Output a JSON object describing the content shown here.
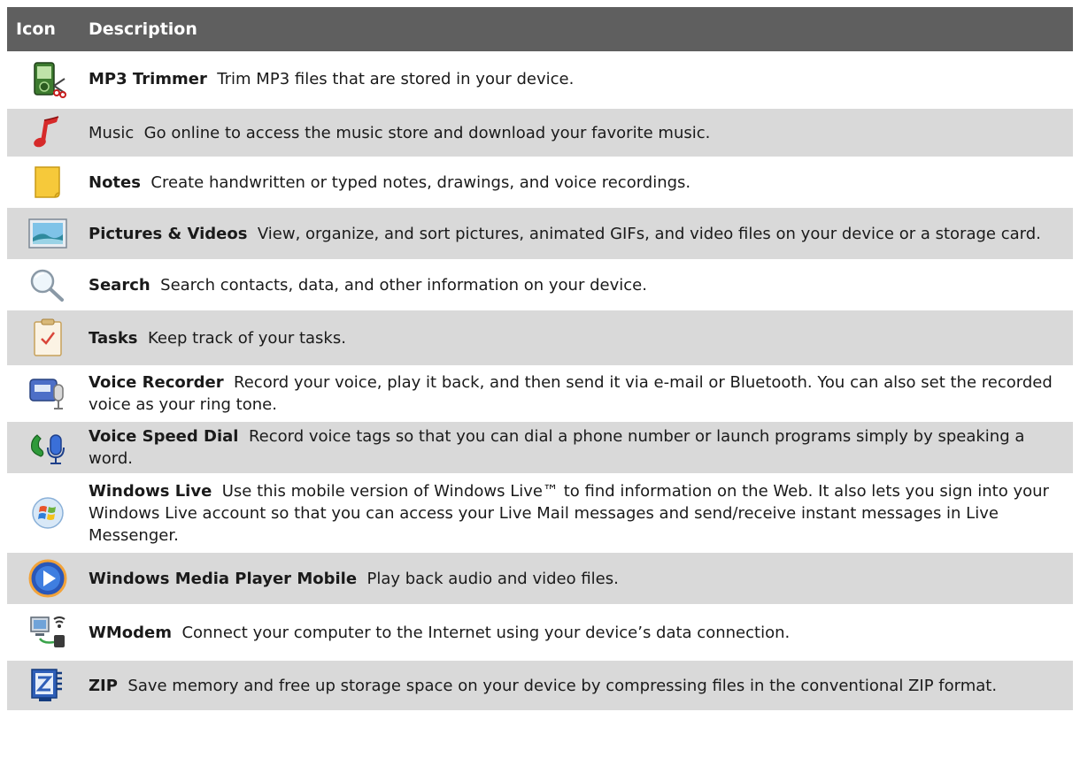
{
  "header": {
    "icon": "Icon",
    "description": "Description"
  },
  "rows": [
    {
      "icon": "mp3-trimmer-icon",
      "name": "MP3 Trimmer",
      "text": "Trim MP3 files that are stored in your device.",
      "bold": true
    },
    {
      "icon": "music-note-icon",
      "name": "Music",
      "text": "Go online to access the music store and download your favorite music.",
      "bold": false
    },
    {
      "icon": "notes-icon",
      "name": "Notes",
      "text": "Create handwritten or typed notes, drawings, and voice recordings.",
      "bold": true
    },
    {
      "icon": "pictures-videos-icon",
      "name": "Pictures & Videos",
      "text": "View, organize, and sort pictures, animated GIFs, and video files on your device or a storage card.",
      "bold": true
    },
    {
      "icon": "search-icon",
      "name": "Search",
      "text": "Search contacts, data, and other information on your device.",
      "bold": true
    },
    {
      "icon": "tasks-icon",
      "name": "Tasks",
      "text": "Keep track of your tasks.",
      "bold": true
    },
    {
      "icon": "voice-recorder-icon",
      "name": "Voice Recorder",
      "text": "Record your voice, play it back, and then send it via e-mail or Bluetooth. You can also set the recorded voice as your ring tone.",
      "bold": true
    },
    {
      "icon": "voice-speed-dial-icon",
      "name": "Voice Speed Dial",
      "text": "Record voice tags so that you can dial a phone number or launch programs simply by speaking a word.",
      "bold": true
    },
    {
      "icon": "windows-live-icon",
      "name": "Windows Live",
      "text": "Use this mobile version of Windows Live™ to find information on the Web. It also lets you sign into your Windows Live account so that you can access your Live Mail messages and send/receive instant messages in Live Messenger.",
      "bold": true
    },
    {
      "icon": "windows-media-player-icon",
      "name": "Windows Media Player Mobile",
      "text": "Play back audio and video files.",
      "bold": true
    },
    {
      "icon": "wmodem-icon",
      "name": "WModem",
      "text": "Connect your computer to the Internet using your device’s data connection.",
      "bold": true
    },
    {
      "icon": "zip-icon",
      "name": "ZIP",
      "text": "Save memory and free up storage space on your device by compressing files in the conventional ZIP format.",
      "bold": true
    }
  ],
  "colors": {
    "header_bg": "#5f5f5f",
    "row_alt_bg": "#d9d9d9",
    "row_plain_bg": "#ffffff"
  }
}
